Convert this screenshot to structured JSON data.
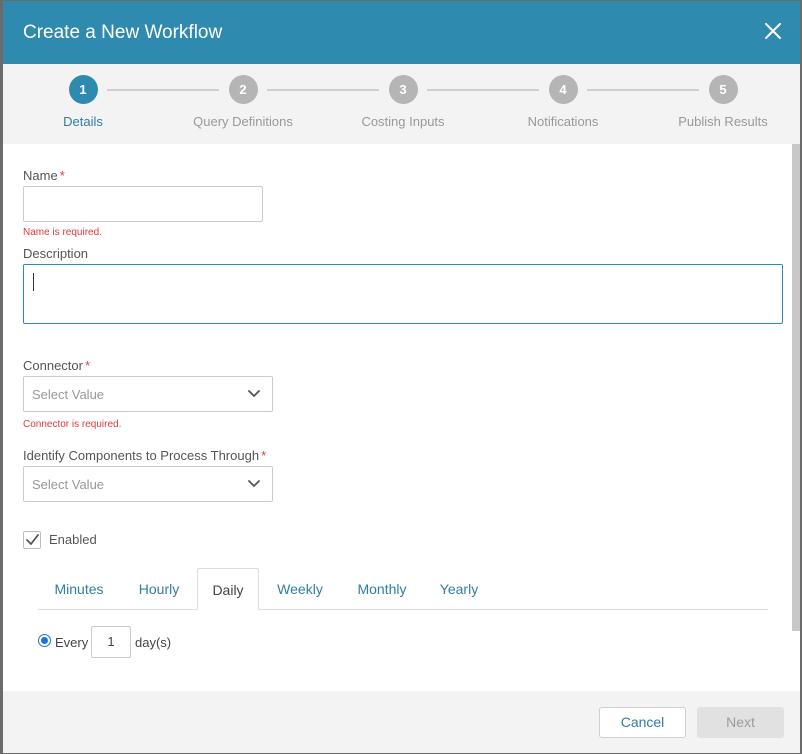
{
  "dialog": {
    "title": "Create a New Workflow"
  },
  "stepper": {
    "steps": [
      {
        "number": "1",
        "label": "Details"
      },
      {
        "number": "2",
        "label": "Query Definitions"
      },
      {
        "number": "3",
        "label": "Costing Inputs"
      },
      {
        "number": "4",
        "label": "Notifications"
      },
      {
        "number": "5",
        "label": "Publish Results"
      }
    ],
    "active_step": "1"
  },
  "form": {
    "name": {
      "label": "Name",
      "required_mark": "*",
      "value": "",
      "error": "Name is required."
    },
    "description": {
      "label": "Description",
      "value": ""
    },
    "connector": {
      "label": "Connector",
      "required_mark": "*",
      "placeholder": "Select Value",
      "error": "Connector is required."
    },
    "components": {
      "label": "Identify Components to Process Through",
      "required_mark": "*",
      "placeholder": "Select Value"
    },
    "enabled": {
      "label": "Enabled",
      "checked": true
    }
  },
  "schedule": {
    "tabs": [
      "Minutes",
      "Hourly",
      "Daily",
      "Weekly",
      "Monthly",
      "Yearly"
    ],
    "active_tab": "Daily",
    "every_label": "Every",
    "every_value": "1",
    "unit_label": "day(s)"
  },
  "footer": {
    "cancel_label": "Cancel",
    "next_label": "Next"
  },
  "colors": {
    "header": "#2f8ab0",
    "accent_text": "#2f7ea3",
    "error": "#e03a3a"
  },
  "icons": {
    "close": "close-icon",
    "dropdown": "chevron-down-icon",
    "check": "check-icon"
  }
}
